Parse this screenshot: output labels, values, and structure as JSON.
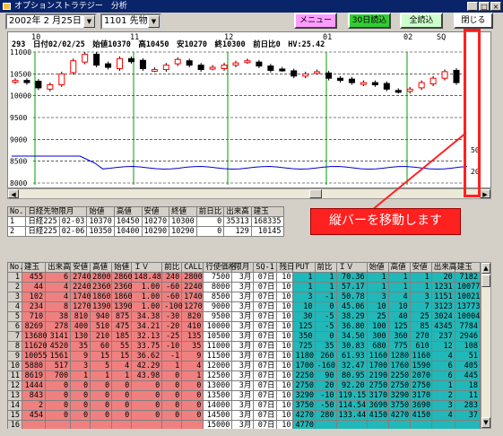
{
  "window": {
    "title": "オプションストラテジー　分析",
    "min": "_",
    "max": "□",
    "close": "×"
  },
  "toolbar": {
    "date_value": "2002年 2 月25日",
    "symbol_value": "1101 先物",
    "menu_label": "メニュー",
    "thirty_day_label": "30日読込",
    "all_label": "全読込",
    "close_label": "閉じる",
    "colors": {
      "menu": "#ff9cff",
      "thirty_day": "#33cc33",
      "all": "#ccffcc",
      "close": "#ffffff"
    }
  },
  "chart": {
    "header": "293　日付02/02/25　始値10370　高10450　安10270　終10300　前日比0　HV:25.42",
    "month_labels": [
      "10",
      "11",
      "12",
      "01",
      "02",
      "SQ"
    ],
    "price_ticks": [
      "11000",
      "10500",
      "10000",
      "9500",
      "9000",
      "8500",
      "8000"
    ],
    "hv_ticks": [
      "50",
      "20"
    ],
    "colors": {
      "up": "#ff0000",
      "down": "#000000",
      "hv": "#0000cc",
      "month_grid": "#00a000",
      "h_grid": "#000000"
    }
  },
  "chart_data": {
    "type": "candlestick",
    "ylim": [
      8000,
      11000
    ],
    "hv_ticks": [
      50,
      20
    ],
    "close_approx": [
      10350,
      10300,
      10180,
      10250,
      10500,
      10800,
      10950,
      10700,
      10650,
      10850,
      10780,
      10620,
      10600,
      10700,
      10830,
      10700,
      10600,
      10650,
      10700,
      10750,
      10800,
      10680,
      10580,
      10600,
      10450,
      10500,
      10550,
      10400,
      10350,
      10300,
      10300,
      10250,
      10150,
      10100,
      10150,
      10300,
      10400,
      10550,
      10300
    ]
  },
  "scroll": {
    "left": "◀",
    "right": "▶",
    "up": "▲",
    "down": "▼"
  },
  "futures": {
    "headers": [
      "No.",
      "日経先物限月",
      "始値",
      "高値",
      "安値",
      "終値",
      "前日比",
      "出来高",
      "建玉"
    ],
    "rows": [
      [
        "1",
        "日経225",
        "02-03",
        "10370",
        "10450",
        "10270",
        "10300",
        "0",
        "35313",
        "168335"
      ],
      [
        "2",
        "日経225",
        "02-06",
        "10350",
        "10400",
        "10290",
        "10290",
        "0",
        "129",
        "10145"
      ]
    ]
  },
  "annotation": "縦バーを移動します",
  "options": {
    "headers": [
      "No.",
      "建玉",
      "出来高",
      "安値",
      "高値",
      "始値",
      "ＩＶ",
      "前比",
      "CALL",
      "行使価格",
      "限月",
      "SQ-1",
      "残日",
      "PUT",
      "前比",
      "ＩＶ",
      "始値",
      "高値",
      "安値",
      "出来高",
      "建玉"
    ],
    "rows": [
      [
        "1",
        "455",
        "6",
        "2740",
        "2800",
        "2860",
        "148.48",
        "240",
        "2800",
        "7500",
        "3月",
        "07日",
        "10",
        "1",
        "1",
        "70.36",
        "1",
        "1",
        "1",
        "20",
        "7182"
      ],
      [
        "2",
        "44",
        "4",
        "2240",
        "2360",
        "2360",
        "1.00",
        "-60",
        "2240",
        "8000",
        "3月",
        "07日",
        "10",
        "1",
        "1",
        "57.17",
        "1",
        "1",
        "1",
        "1231",
        "10077"
      ],
      [
        "3",
        "102",
        "4",
        "1740",
        "1860",
        "1860",
        "1.00",
        "-60",
        "1740",
        "8500",
        "3月",
        "07日",
        "10",
        "3",
        "-1",
        "50.78",
        "3",
        "4",
        "3",
        "1151",
        "10021"
      ],
      [
        "4",
        "234",
        "8",
        "1270",
        "1390",
        "1390",
        "1.00",
        "-100",
        "1270",
        "9000",
        "3月",
        "07日",
        "10",
        "10",
        "0",
        "45.06",
        "10",
        "10",
        "7",
        "3123",
        "13773"
      ],
      [
        "5",
        "710",
        "38",
        "810",
        "940",
        "875",
        "34.38",
        "-30",
        "820",
        "9500",
        "3月",
        "07日",
        "10",
        "30",
        "-5",
        "38.29",
        "25",
        "40",
        "25",
        "3024",
        "10004"
      ],
      [
        "6",
        "8269",
        "278",
        "400",
        "510",
        "475",
        "34.21",
        "-20",
        "410",
        "10000",
        "3月",
        "07日",
        "10",
        "125",
        "-5",
        "36.80",
        "100",
        "125",
        "85",
        "4345",
        "7784"
      ],
      [
        "7",
        "13680",
        "3141",
        "130",
        "210",
        "185",
        "32.13",
        "-25",
        "135",
        "10500",
        "3月",
        "07日",
        "10",
        "350",
        "0",
        "34.50",
        "300",
        "360",
        "270",
        "237",
        "2946"
      ],
      [
        "8",
        "11620",
        "4520",
        "35",
        "60",
        "55",
        "33.75",
        "-10",
        "35",
        "11000",
        "3月",
        "07日",
        "10",
        "725",
        "35",
        "30.83",
        "680",
        "775",
        "610",
        "12",
        "108"
      ],
      [
        "9",
        "10055",
        "1561",
        "9",
        "15",
        "15",
        "36.62",
        "-1",
        "9",
        "11500",
        "3月",
        "07日",
        "10",
        "1180",
        "260",
        "61.93",
        "1160",
        "1280",
        "1160",
        "4",
        "51"
      ],
      [
        "10",
        "5880",
        "517",
        "3",
        "5",
        "4",
        "42.29",
        "1",
        "4",
        "12000",
        "3月",
        "07日",
        "10",
        "1700",
        "-160",
        "32.47",
        "1700",
        "1760",
        "1590",
        "6",
        "405"
      ],
      [
        "11",
        "8619",
        "700",
        "1",
        "1",
        "1",
        "43.98",
        "0",
        "1",
        "12500",
        "3月",
        "07日",
        "10",
        "2250",
        "90",
        "80.95",
        "2190",
        "2250",
        "2070",
        "6",
        "445"
      ],
      [
        "12",
        "1444",
        "0",
        "0",
        "0",
        "0",
        "0",
        "0",
        "0",
        "13000",
        "3月",
        "07日",
        "10",
        "2750",
        "20",
        "92.20",
        "2750",
        "2750",
        "2750",
        "1",
        "18"
      ],
      [
        "13",
        "843",
        "0",
        "0",
        "0",
        "0",
        "0",
        "0",
        "0",
        "13500",
        "3月",
        "07日",
        "10",
        "3290",
        "-10",
        "119.15",
        "3170",
        "3290",
        "3170",
        "2",
        "11"
      ],
      [
        "14",
        "2",
        "0",
        "0",
        "0",
        "0",
        "0",
        "0",
        "0",
        "14000",
        "3月",
        "07日",
        "10",
        "3750",
        "-50",
        "114.54",
        "3690",
        "3750",
        "3690",
        "3",
        "283"
      ],
      [
        "15",
        "454",
        "0",
        "0",
        "0",
        "0",
        "0",
        "0",
        "0",
        "14500",
        "3月",
        "07日",
        "10",
        "4270",
        "280",
        "133.44",
        "4150",
        "4270",
        "4150",
        "4",
        "37"
      ],
      [
        "16",
        "",
        "",
        "",
        "",
        "",
        "",
        "",
        "",
        "15000",
        "3月",
        "07日",
        "10",
        "4770",
        "",
        "",
        "",
        "",
        "",
        "",
        ""
      ]
    ]
  }
}
